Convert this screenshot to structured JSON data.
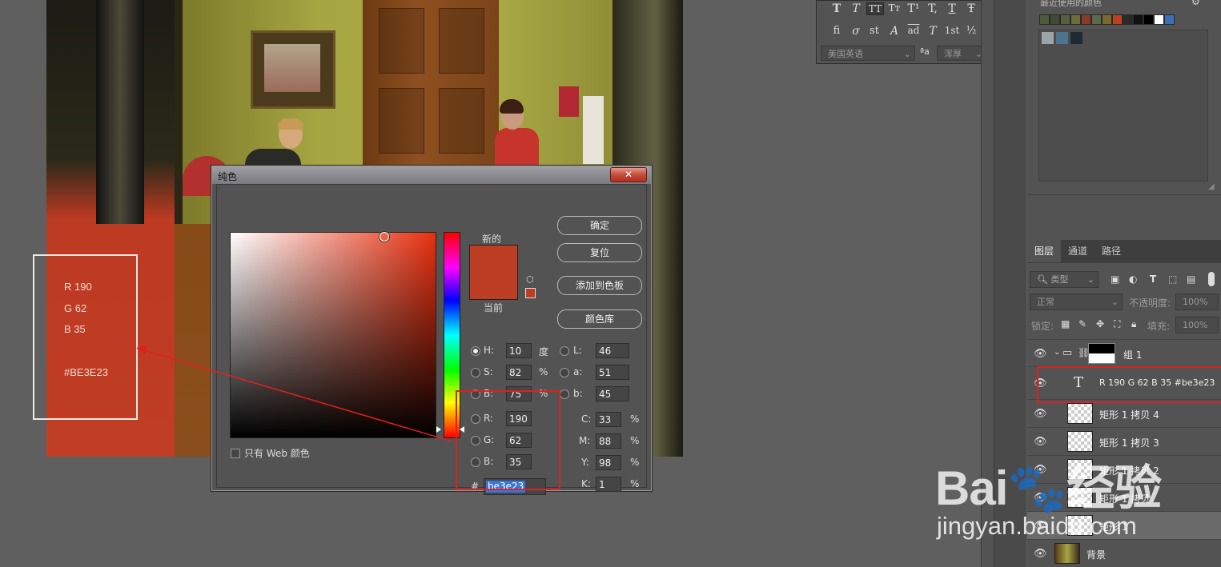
{
  "canvas": {
    "annotation": {
      "r": "R 190",
      "g": "G 62",
      "b": "B 35",
      "hex": "#BE3E23"
    }
  },
  "dialog": {
    "title": "纯色",
    "close_label": "✕",
    "label_new": "新的",
    "label_current": "当前",
    "buttons": {
      "ok": "确定",
      "reset": "复位",
      "add_swatch": "添加到色板",
      "libraries": "颜色库"
    },
    "web_only_label": "只有 Web 颜色",
    "fields": {
      "H": {
        "label": "H:",
        "value": "10",
        "unit": "度"
      },
      "S": {
        "label": "S:",
        "value": "82",
        "unit": "%"
      },
      "B": {
        "label": "B:",
        "value": "75",
        "unit": "%"
      },
      "R": {
        "label": "R:",
        "value": "190"
      },
      "G": {
        "label": "G:",
        "value": "62"
      },
      "Bl": {
        "label": "B:",
        "value": "35"
      },
      "L": {
        "label": "L:",
        "value": "46"
      },
      "a": {
        "label": "a:",
        "value": "51"
      },
      "b": {
        "label": "b:",
        "value": "45"
      },
      "C": {
        "label": "C:",
        "value": "33",
        "unit": "%"
      },
      "M": {
        "label": "M:",
        "value": "88",
        "unit": "%"
      },
      "Y": {
        "label": "Y:",
        "value": "98",
        "unit": "%"
      },
      "K": {
        "label": "K:",
        "value": "1",
        "unit": "%"
      }
    },
    "hex_label": "#",
    "hex_value": "be3e23",
    "current_color": "#be3e23"
  },
  "character_panel": {
    "row1": [
      "T",
      "T",
      "TT",
      "Tт",
      "T¹",
      "T,",
      "T",
      "Ŧ"
    ],
    "row2": [
      "fi",
      "σ",
      "st",
      "A",
      "ad",
      "T",
      "1st",
      "½"
    ],
    "language": "美国英语",
    "aa_icon": "ªa",
    "antialias": "浑厚"
  },
  "swatches_panel": {
    "recent_label": "最近使用的颜色",
    "recent_colors": [
      "#4a5a3a",
      "#3e4a33",
      "#556040",
      "#6b6e3a",
      "#8a3a2a",
      "#5a6a4a",
      "#7a6a2e",
      "#c03e23",
      "#2a2a2a",
      "#111111",
      "#000000",
      "#ffffff",
      "#3e6fb8"
    ],
    "extra_colors": [
      "#9aa4aa",
      "#4e7590",
      "#1f2a33"
    ]
  },
  "layers_panel": {
    "tabs": [
      "图层",
      "通道",
      "路径"
    ],
    "filter_label": "类型",
    "blend_mode": "正常",
    "opacity_label": "不透明度:",
    "opacity_value": "100%",
    "lock_label": "锁定:",
    "fill_label": "填充:",
    "fill_value": "100%",
    "layers": [
      {
        "name": "组 1"
      },
      {
        "name": "R 190 G 62 B 35  #be3e23"
      },
      {
        "name": "矩形 1 拷贝 4"
      },
      {
        "name": "矩形 1 拷贝 3"
      },
      {
        "name": "矩形 1 拷贝 2"
      },
      {
        "name": "矩形 1 拷贝"
      },
      {
        "name": "矩形 1"
      },
      {
        "name": "背景"
      }
    ]
  },
  "watermark": {
    "logo": "Bai🐾经验",
    "url": "jingyan.baidu.com"
  }
}
